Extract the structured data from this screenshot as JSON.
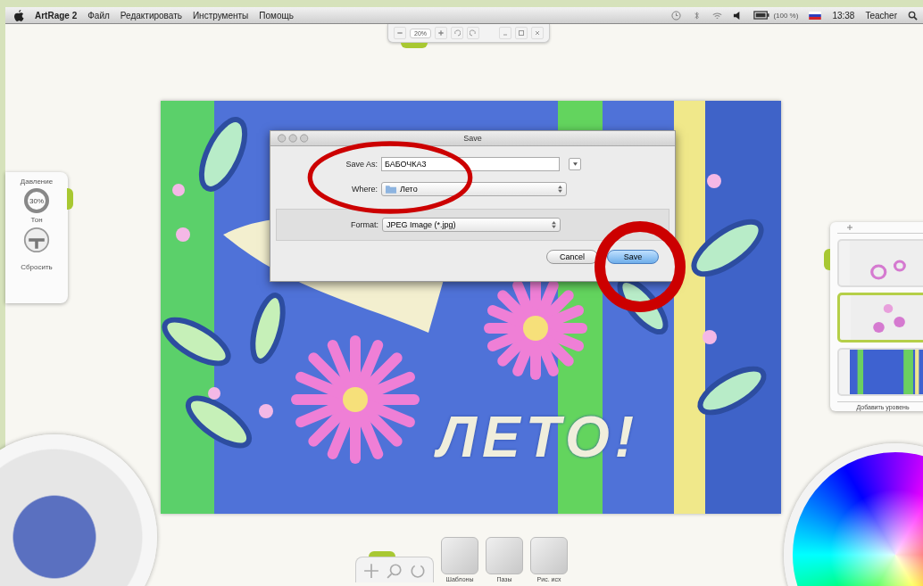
{
  "menu_bar": {
    "app": "ArtRage 2",
    "items": [
      "Файл",
      "Редактировать",
      "Инструменты",
      "Помощь"
    ],
    "battery": "(100 %)",
    "time": "13:38",
    "user": "Teacher"
  },
  "zoom_bar": {
    "value": "20%"
  },
  "tool_settings": {
    "pressure_label": "Давление",
    "pressure": "30%",
    "tone_label": "Тон",
    "reset": "Сбросить"
  },
  "painting": {
    "text": "ЛЕТО!"
  },
  "dialog": {
    "title": "Save",
    "save_as_label": "Save As:",
    "save_as": "БАБОЧКА3",
    "where_label": "Where:",
    "where": "Лето",
    "format_label": "Format:",
    "format": "JPEG Image (*.jpg)",
    "buttons": [
      {
        "label": "Cancel",
        "default": false
      },
      {
        "label": "Save",
        "default": true
      }
    ]
  },
  "layers": {
    "items": [
      {
        "kind": "circles",
        "selected": false
      },
      {
        "kind": "flowers",
        "selected": true
      },
      {
        "kind": "stripes",
        "selected": false
      }
    ],
    "add": "Добавить уровень"
  },
  "bottom_toolbar": {
    "items": [
      "Шаблоны",
      "Пазы",
      "Рис. исх"
    ]
  }
}
